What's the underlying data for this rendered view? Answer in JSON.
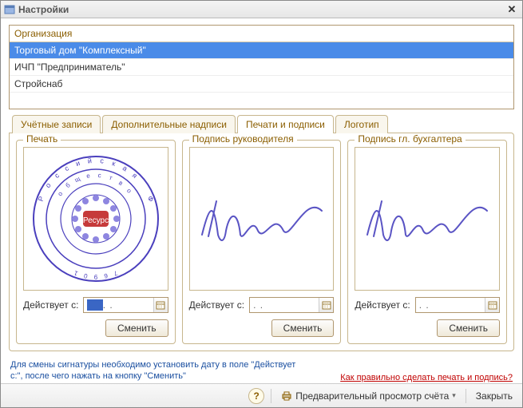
{
  "window": {
    "title": "Настройки"
  },
  "org": {
    "header": "Организация",
    "rows": [
      "Торговый дом \"Комплексный\"",
      "ИЧП \"Предприниматель\"",
      "Стройснаб"
    ],
    "selected_index": 0
  },
  "tabs": {
    "items": [
      "Учётные записи",
      "Дополнительные надписи",
      "Печати и подписи",
      "Логотип"
    ],
    "active_index": 2
  },
  "groups": {
    "stamp": {
      "legend": "Печать",
      "date_label": "Действует с:",
      "date_value": "  .  .    ",
      "change": "Сменить"
    },
    "sign1": {
      "legend": "Подпись руководителя",
      "date_label": "Действует с:",
      "date_value": "  .  .    ",
      "change": "Сменить"
    },
    "sign2": {
      "legend": "Подпись гл. бухгалтера",
      "date_label": "Действует с:",
      "date_value": "  .  .    ",
      "change": "Сменить"
    }
  },
  "hint": {
    "left": "Для смены сигнатуры необходимо установить дату в поле \"Действует с:\", после чего нажать на кнопку \"Сменить\"",
    "right": "Как правильно сделать печать и подпись?"
  },
  "footer": {
    "preview": "Предварительный просмотр счёта",
    "close": "Закрыть"
  },
  "icons": {
    "close_glyph": "✕",
    "help_glyph": "?",
    "dropdown_glyph": "▾"
  },
  "colors": {
    "accent_brown": "#8b5e00",
    "selection_blue": "#4a8be8",
    "hint_blue": "#1a4fa0",
    "link_red": "#c00000",
    "stamp_purple": "#4a3fbd",
    "signature_ink": "#5a54c4"
  }
}
